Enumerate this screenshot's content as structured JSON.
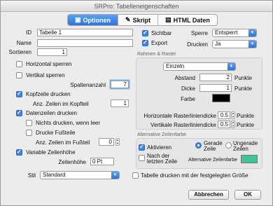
{
  "window": {
    "title": "SRPro: Tabelleneigenschaften"
  },
  "tabs": [
    {
      "label": "Optionen",
      "icon": "options-icon"
    },
    {
      "label": "Skript",
      "icon": "script-icon"
    },
    {
      "label": "HTML Daten",
      "icon": "html-icon"
    }
  ],
  "left": {
    "id_label": "ID",
    "id_value": "Tabelle 1",
    "name_label": "Name",
    "name_value": "",
    "sort_label": "Sortieren",
    "sort_value": "1",
    "horizontal_lock": "Horizontal sperren",
    "vertical_lock": "Vertikal sperren",
    "column_count_label": "Spaltenanzahl",
    "column_count_value": "7",
    "print_header": "Kopfzeile drucken",
    "header_rows_label": "Anz. Zeilen im Kopfteil",
    "header_rows_value": "1",
    "print_data_rows": "Datenzeilen drucken",
    "skip_empty": "Nichts drucken, wenn leer",
    "print_footer": "Drucke Fußteile",
    "footer_rows_label": "Anz. Zeilen im Fußteil",
    "footer_rows_value": "0",
    "variable_row_height": "Variable Zeilenhöhe",
    "row_height_label": "Zeilenhöhe",
    "row_height_value": "0 Pt",
    "style_label": "Stil",
    "style_value": "Standard"
  },
  "right": {
    "visible": "Sichtbar",
    "export": "Export",
    "lock_label": "Sperre",
    "lock_value": "Entsperrt",
    "print_label": "Drucken",
    "print_value": "Ja",
    "frame_group": "Rahmen & Raster",
    "frame_select": "Einzeln",
    "distance_label": "Abstand",
    "distance_value": "2",
    "thickness_label": "Dicke",
    "thickness_value": "1",
    "unit": "Punkte",
    "color_label": "Farbe",
    "frame_color": "#000000",
    "h_grid_label": "Horizontale Rasterliniendicke",
    "h_grid_value": "0.5",
    "v_grid_label": "Vertikale Rasterliniendicke",
    "v_grid_value": "0.5",
    "alt_group": "Alternative Zeilenfarbe",
    "activate": "Aktivieren",
    "even_rows": "Gerade Zeile",
    "odd_rows": "Ungerade Zeilen",
    "after_last_row": "Nach der letzten Zeile",
    "alt_color_label": "Alternative Zeilenfarbe",
    "alt_color": "#3ec39a",
    "print_fixed_size": "Tabelle drucken mit der festgelegten Größe"
  },
  "footer": {
    "cancel": "Abbrechen",
    "ok": "OK"
  }
}
